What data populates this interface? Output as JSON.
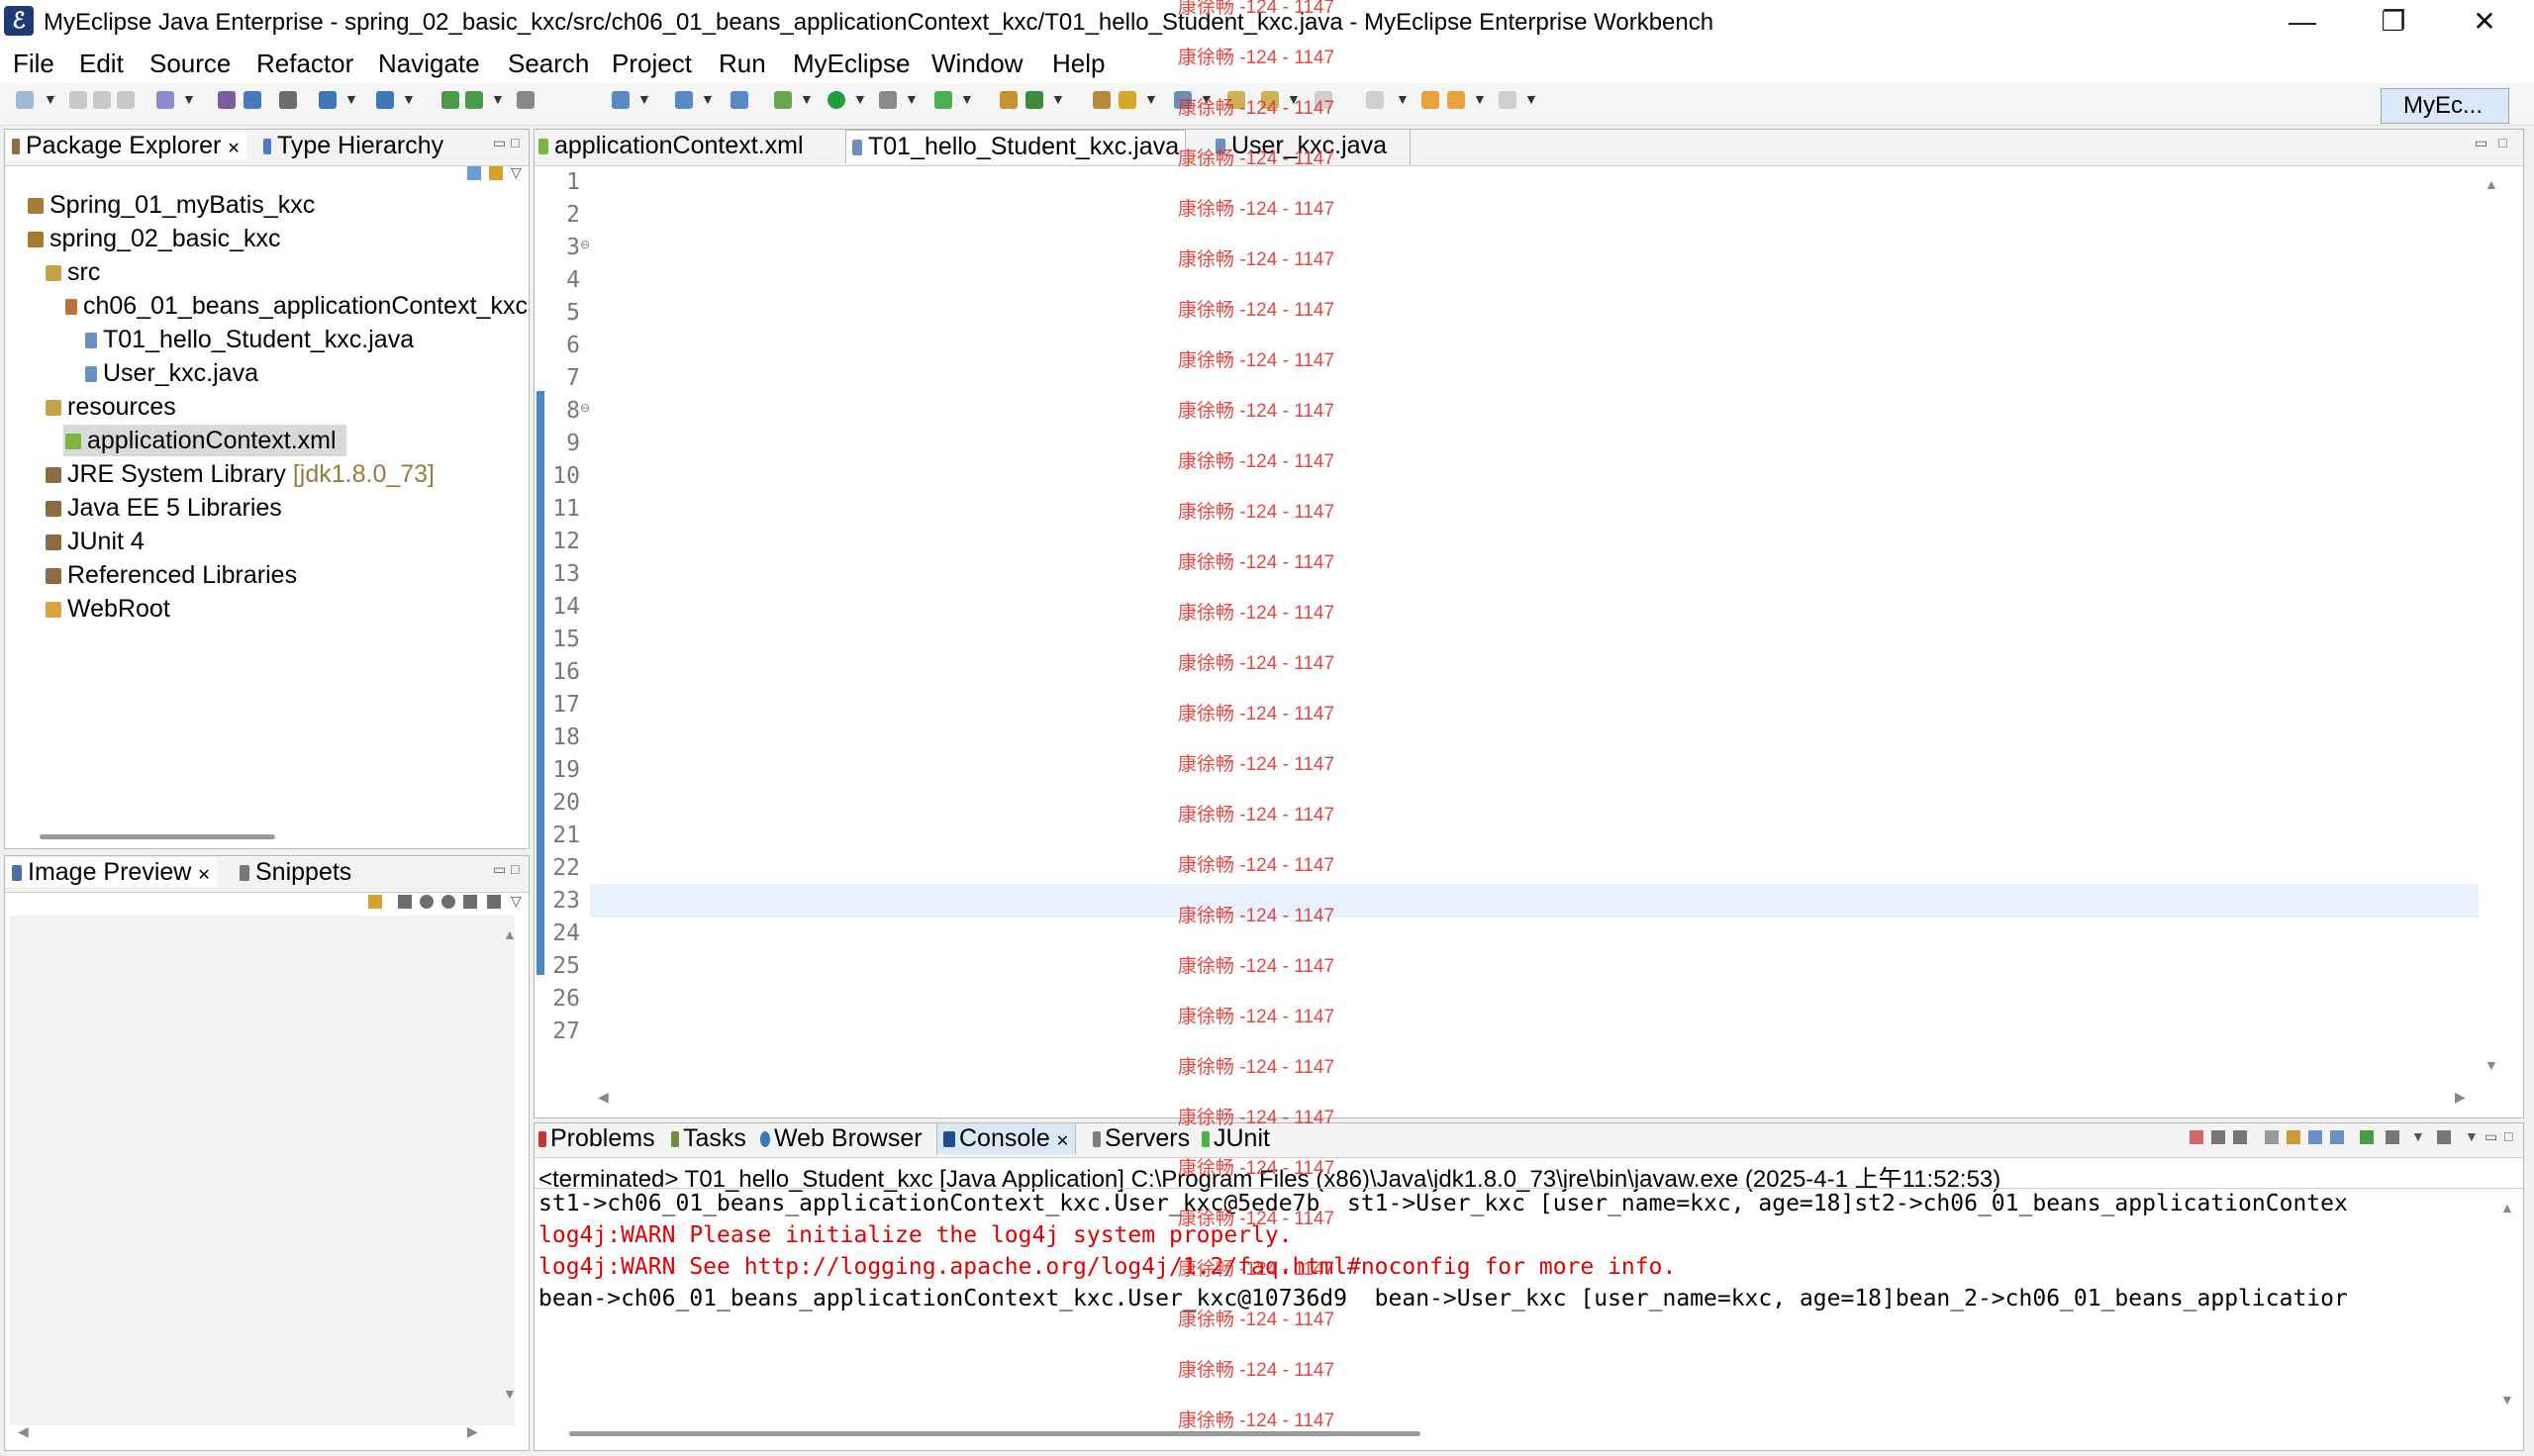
{
  "window": {
    "title": "MyEclipse Java Enterprise - spring_02_basic_kxc/src/ch06_01_beans_applicationContext_kxc/T01_hello_Student_kxc.java - MyEclipse Enterprise Workbench",
    "minimize": "—",
    "maximize": "❐",
    "close": "✕"
  },
  "menu": [
    "File",
    "Edit",
    "Source",
    "Refactor",
    "Navigate",
    "Search",
    "Project",
    "Run",
    "MyEclipse",
    "Window",
    "Help"
  ],
  "perspective": "MyEc...",
  "explorer": {
    "tabs": [
      "Package Explorer",
      "Type Hierarchy"
    ],
    "tree": [
      {
        "label": "Spring_01_myBatis_kxc"
      },
      {
        "label": "spring_02_basic_kxc"
      },
      {
        "label": "src"
      },
      {
        "label": "ch06_01_beans_applicationContext_kxc"
      },
      {
        "label": "T01_hello_Student_kxc.java"
      },
      {
        "label": "User_kxc.java"
      },
      {
        "label": "resources"
      },
      {
        "label": "applicationContext.xml"
      },
      {
        "label": "JRE System Library",
        "suffix": "[jdk1.8.0_73]"
      },
      {
        "label": "Java EE 5 Libraries"
      },
      {
        "label": "JUnit 4"
      },
      {
        "label": "Referenced Libraries"
      },
      {
        "label": "WebRoot"
      }
    ]
  },
  "preview": {
    "tabs": [
      "Image Preview",
      "Snippets"
    ]
  },
  "editor": {
    "tabs": [
      "applicationContext.xml",
      "T01_hello_Student_kxc.java",
      "User_kxc.java"
    ],
    "line_numbers": [
      "1",
      "2",
      "3",
      "4",
      "5",
      "6",
      "7",
      "8",
      "9",
      "10",
      "11",
      "12",
      "13",
      "14",
      "15",
      "16",
      "17",
      "18",
      "19",
      "20",
      "21",
      "22",
      "23",
      "24",
      "25",
      "26",
      "27"
    ]
  },
  "bottom": {
    "tabs": [
      "Problems",
      "Tasks",
      "Web Browser",
      "Console",
      "Servers",
      "JUnit"
    ],
    "header": "<terminated> T01_hello_Student_kxc [Java Application] C:\\Program Files (x86)\\Java\\jdk1.8.0_73\\jre\\bin\\javaw.exe (2025-4-1 上午11:52:53)",
    "lines": [
      "st1->ch06_01_beans_applicationContext_kxc.User_kxc@5ede7b  st1->User_kxc [user_name=kxc, age=18]st2->ch06_01_beans_applicationContex",
      "log4j:WARN Please initialize the log4j system properly.",
      "log4j:WARN See http://logging.apache.org/log4j/1.2/faq.html#noconfig for more info.",
      "bean->ch06_01_beans_applicationContext_kxc.User_kxc@10736d9  bean->User_kxc [user_name=kxc, age=18]bean_2->ch06_01_beans_applicatior"
    ]
  },
  "watermark": "康徐畅 -124 - 1147",
  "colors": {
    "keyword": "#7f0055",
    "string": "#2a00ff",
    "field": "#0000c0",
    "comment": "#3f7f5f",
    "warn": "#e00000",
    "watermark": "#e3342f"
  }
}
